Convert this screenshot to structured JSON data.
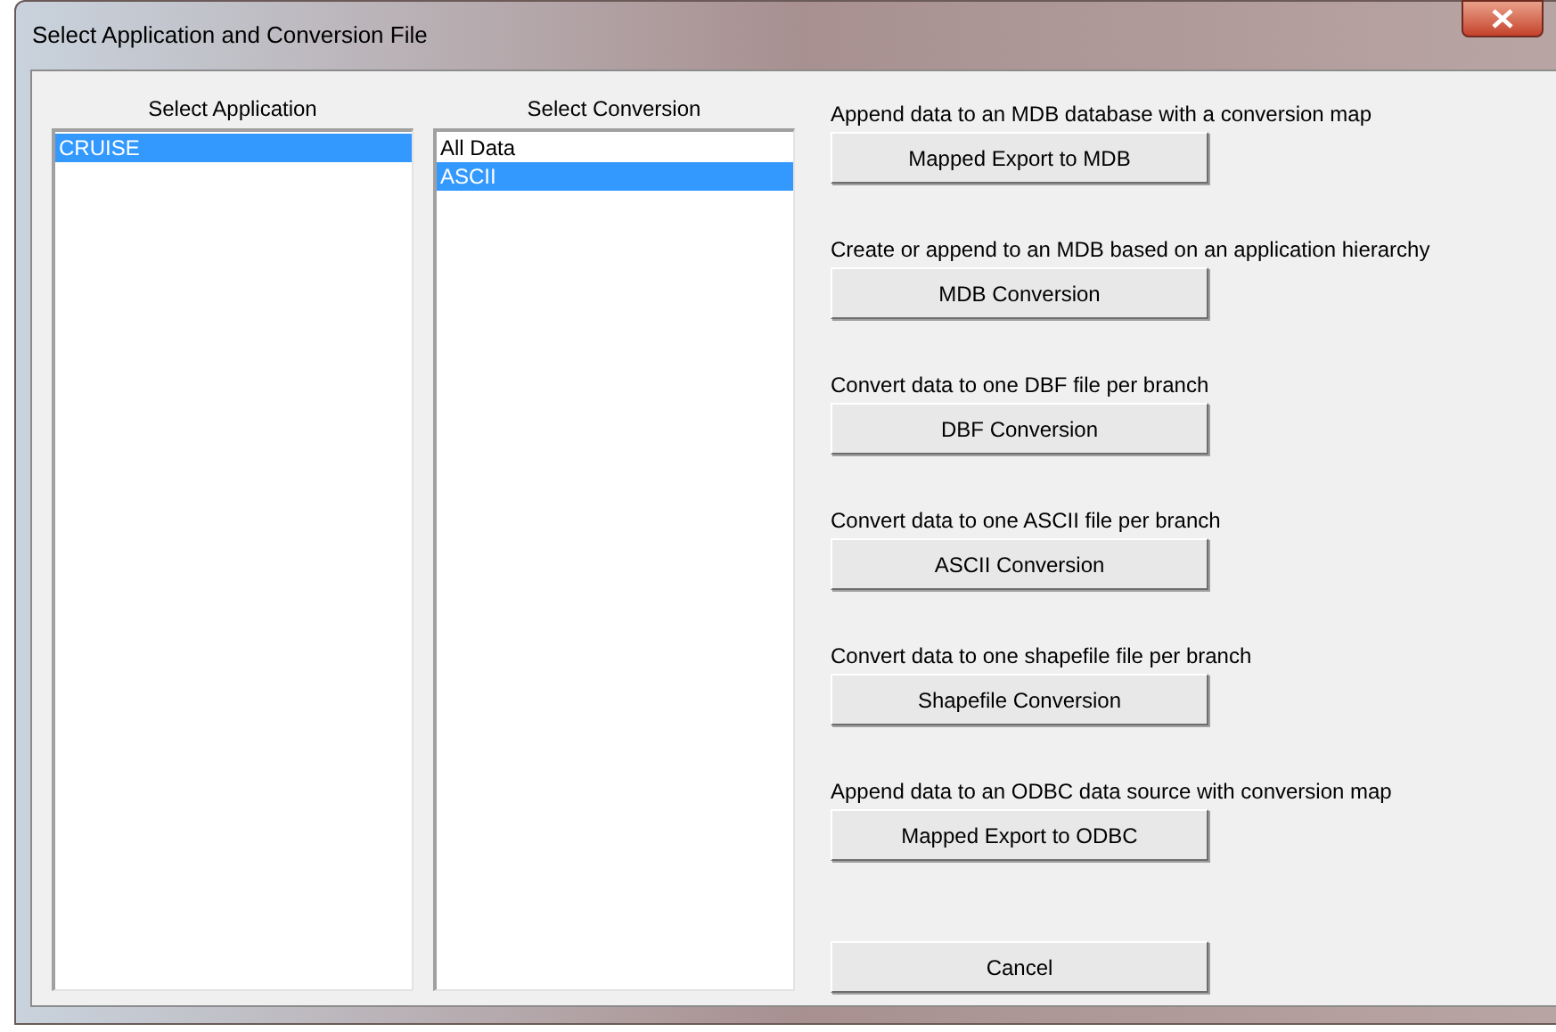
{
  "window": {
    "title": "Select Application and Conversion File"
  },
  "application_list": {
    "heading": "Select Application",
    "items": [
      {
        "label": "CRUISE",
        "selected": true
      }
    ]
  },
  "conversion_list": {
    "heading": "Select Conversion",
    "items": [
      {
        "label": "All Data",
        "selected": false
      },
      {
        "label": "ASCII",
        "selected": true
      }
    ]
  },
  "actions": [
    {
      "description": "Append data to an MDB database with a conversion map",
      "button": "Mapped Export to MDB"
    },
    {
      "description": "Create or append to an MDB based on an application hierarchy",
      "button": "MDB Conversion"
    },
    {
      "description": "Convert data to one DBF file per branch",
      "button": "DBF Conversion"
    },
    {
      "description": "Convert data to one ASCII file per branch",
      "button": "ASCII Conversion"
    },
    {
      "description": "Convert data to one shapefile file per branch",
      "button": "Shapefile Conversion"
    },
    {
      "description": "Append data to an ODBC data source with conversion map",
      "button": "Mapped Export to ODBC"
    }
  ],
  "cancel_button": "Cancel"
}
